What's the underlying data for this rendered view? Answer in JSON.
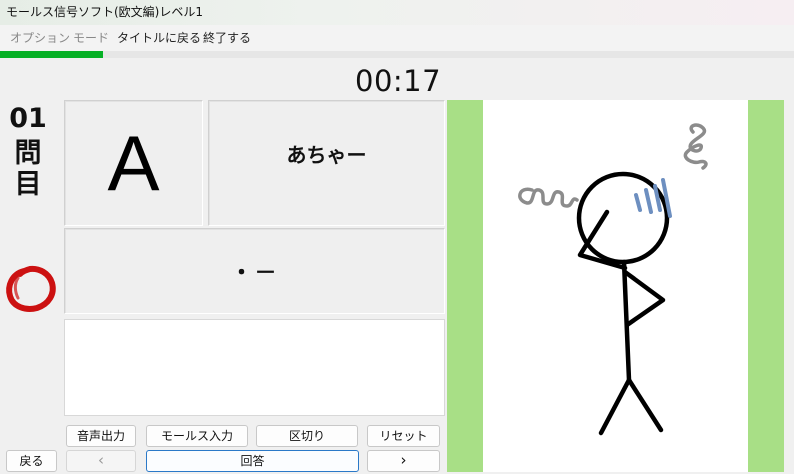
{
  "window": {
    "title": "モールス信号ソフト(欧文編)レベル1"
  },
  "menu": [
    {
      "label": "オプション",
      "dim": true
    },
    {
      "label": "モード",
      "dim": true
    },
    {
      "label": "タイトルに戻る",
      "dim": false
    },
    {
      "label": "終了する",
      "dim": false
    }
  ],
  "progress": {
    "fraction": 0.13,
    "color": "#06b025"
  },
  "timer": "00:17",
  "question": {
    "number": "01",
    "label": "問目"
  },
  "current": {
    "letter": "A",
    "mnemonic": "あちゃー",
    "code": "・－"
  },
  "answer_input": {
    "value": ""
  },
  "buttons": {
    "back": "戻る",
    "prev": "‹",
    "next": "›",
    "audio": "音声出力",
    "morse_input": "モールス入力",
    "separator": "区切り",
    "reset": "リセット",
    "answer": "回答"
  },
  "colors": {
    "accent_green": "#a8df86",
    "result_mark": "#cc1111",
    "sweat": "#6d8fc0"
  },
  "icons": {
    "result": "correct-circle-icon"
  }
}
